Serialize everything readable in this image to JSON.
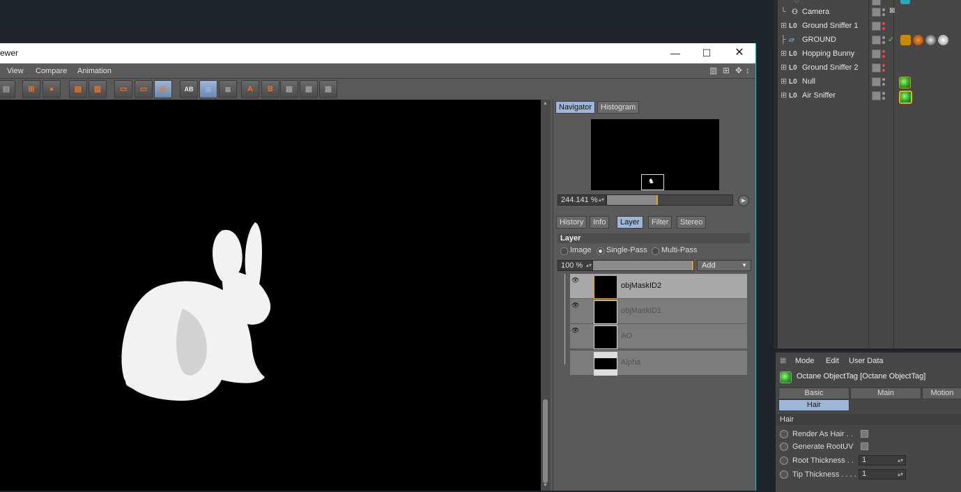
{
  "window": {
    "title": "ewer",
    "menu": [
      "View",
      "Compare",
      "Animation"
    ]
  },
  "toolbar": {
    "buttons": [
      "AB",
      "A",
      "B"
    ]
  },
  "navigator": {
    "tabs": [
      "Navigator",
      "Histogram"
    ],
    "zoom": "244.141 %"
  },
  "panel_tabs": [
    "History",
    "Info",
    "Layer",
    "Filter",
    "Stereo"
  ],
  "layer_panel": {
    "header": "Layer",
    "modes": [
      "Image",
      "Single-Pass",
      "Multi-Pass"
    ],
    "selected_mode": "Single-Pass",
    "opacity": "100 %",
    "add_label": "Add",
    "layers": [
      {
        "name": "objMaskID2",
        "selected": true
      },
      {
        "name": "objMaskID1",
        "selected": false
      },
      {
        "name": "AO",
        "selected": false
      },
      {
        "name": "Alpha",
        "selected": false
      }
    ]
  },
  "object_manager": {
    "objects": [
      "Camera",
      "Ground Sniffer 1",
      "GROUND",
      "Hopping Bunny",
      "Ground Sniffer 2",
      "Null",
      "Air Sniffer"
    ]
  },
  "attributes": {
    "menu": [
      "Mode",
      "Edit",
      "User Data"
    ],
    "title": "Octane ObjectTag [Octane ObjectTag]",
    "tabs": [
      "Basic",
      "Main",
      "Motion",
      "Hair"
    ],
    "section": "Hair",
    "fields": [
      {
        "label": "Render As Hair . .",
        "type": "checkbox"
      },
      {
        "label": "Generate RootUV",
        "type": "checkbox"
      },
      {
        "label": "Root Thickness . .",
        "type": "number",
        "value": "1"
      },
      {
        "label": "Tip Thickness . . . .",
        "type": "number",
        "value": "1"
      }
    ]
  },
  "colors": {
    "accent": "#9db6d6",
    "window_border": "#2ab4c0",
    "panel_bg": "#595959"
  }
}
